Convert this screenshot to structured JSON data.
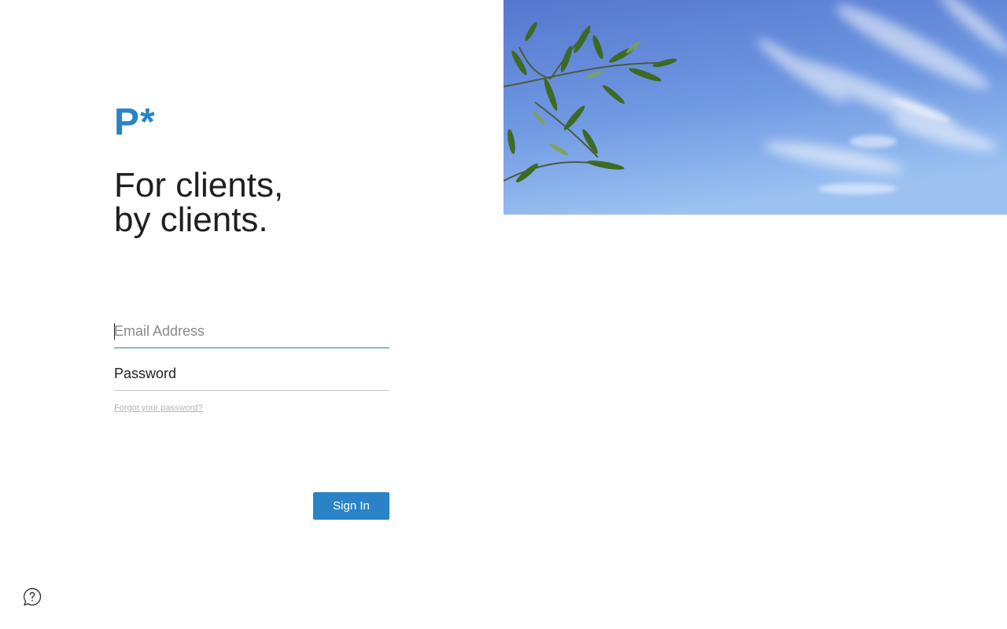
{
  "brand": {
    "logo_text": "P*",
    "accent_color": "#2b82c6"
  },
  "hero": {
    "tagline_line1": "For clients,",
    "tagline_line2": "by clients.",
    "image_icon": "olive-branch-sky-photo"
  },
  "login_form": {
    "email_placeholder": "Email Address",
    "email_value": "",
    "password_placeholder": "Password",
    "password_value": "",
    "forgot_password_link": "Forgot your password?",
    "sign_in_button": "Sign In"
  },
  "footer": {
    "help_icon": "help-chat-icon"
  }
}
